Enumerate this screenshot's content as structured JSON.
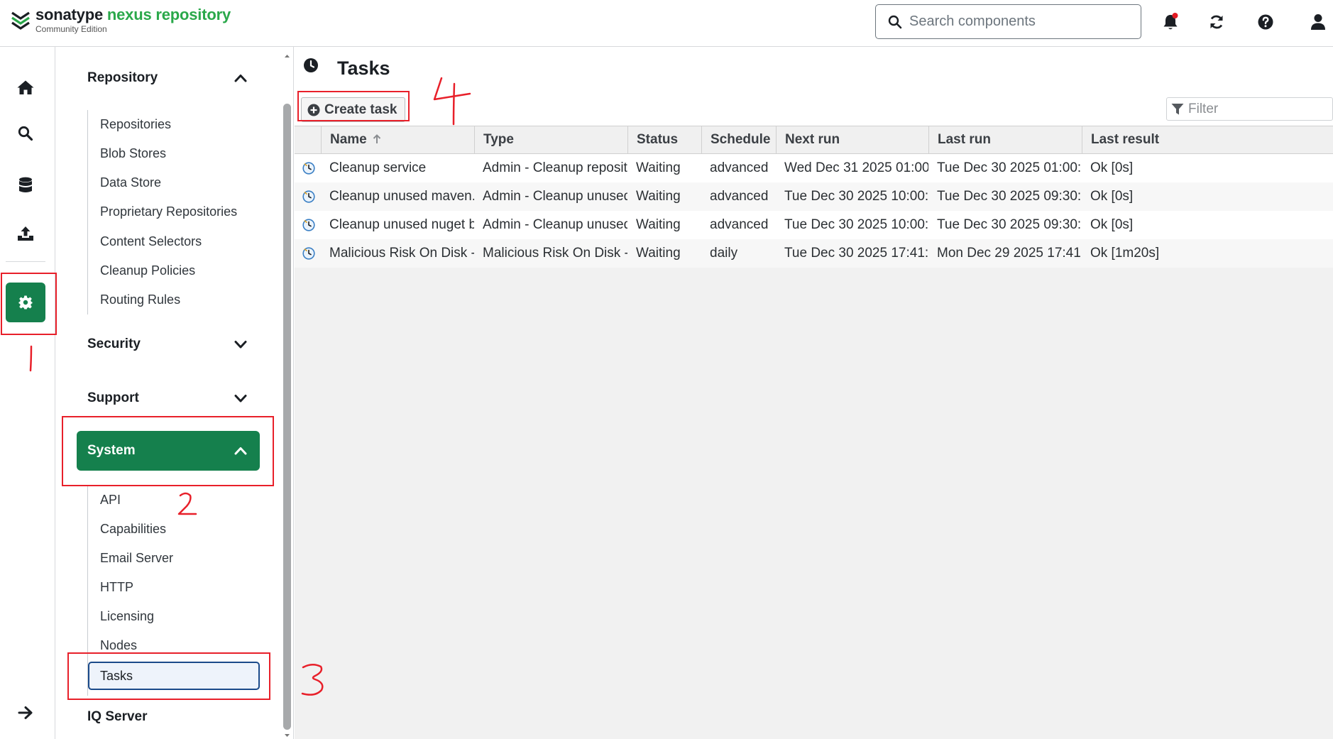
{
  "header": {
    "brand": "sonatype",
    "product": "nexus repository",
    "edition": "Community Edition",
    "search_placeholder": "Search components",
    "icons": [
      "bell-icon",
      "refresh-icon",
      "help-icon",
      "user-icon"
    ]
  },
  "rail": {
    "items": [
      "home-icon",
      "search-icon",
      "database-icon",
      "upload-icon",
      "gear-icon"
    ],
    "footer": "arrow-right-icon"
  },
  "sidebar": {
    "sections": [
      {
        "label": "Repository",
        "expanded": true,
        "items": [
          "Repositories",
          "Blob Stores",
          "Data Store",
          "Proprietary Repositories",
          "Content Selectors",
          "Cleanup Policies",
          "Routing Rules"
        ]
      },
      {
        "label": "Security",
        "expanded": false
      },
      {
        "label": "Support",
        "expanded": false
      },
      {
        "label": "System",
        "expanded": true,
        "active": true,
        "items": [
          "API",
          "Capabilities",
          "Email Server",
          "HTTP",
          "Licensing",
          "Nodes",
          "Tasks"
        ]
      },
      {
        "label": "IQ Server",
        "expanded": false
      }
    ],
    "active_item": "Tasks"
  },
  "main": {
    "title": "Tasks",
    "create_button": "Create task",
    "filter_placeholder": "Filter",
    "columns": [
      "Name",
      "Type",
      "Status",
      "Schedule",
      "Next run",
      "Last run",
      "Last result"
    ],
    "rows": [
      [
        "Cleanup service",
        "Admin - Cleanup reposit...",
        "Waiting",
        "advanced",
        "Wed Dec 31 2025 01:00:...",
        "Tue Dec 30 2025 01:00:...",
        "Ok [0s]"
      ],
      [
        "Cleanup unused maven...",
        "Admin - Cleanup unused...",
        "Waiting",
        "advanced",
        "Tue Dec 30 2025 10:00:...",
        "Tue Dec 30 2025 09:30:...",
        "Ok [0s]"
      ],
      [
        "Cleanup unused nuget b...",
        "Admin - Cleanup unused...",
        "Waiting",
        "advanced",
        "Tue Dec 30 2025 10:00:...",
        "Tue Dec 30 2025 09:30:...",
        "Ok [0s]"
      ],
      [
        "Malicious Risk On Disk - ...",
        "Malicious Risk On Disk - ...",
        "Waiting",
        "daily",
        "Tue Dec 30 2025 17:41:0...",
        "Mon Dec 29 2025 17:41:...",
        "Ok [1m20s]"
      ]
    ]
  },
  "annotations": {
    "colors": {
      "accent": "#15804d",
      "annotation": "#e8202a"
    }
  }
}
